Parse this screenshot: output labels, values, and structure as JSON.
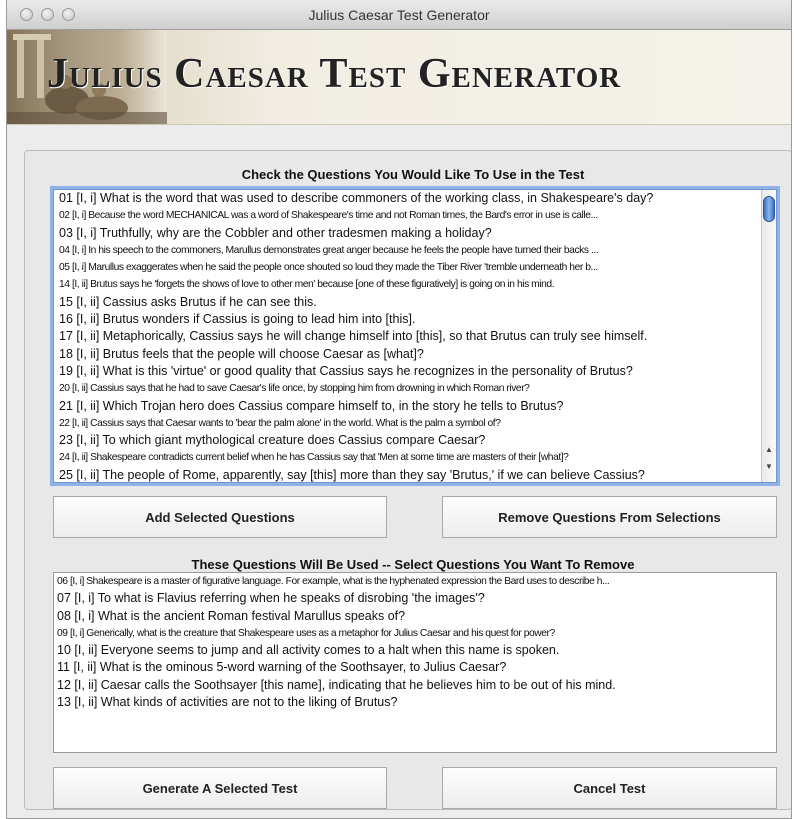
{
  "window": {
    "title": "Julius Caesar Test Generator"
  },
  "banner": {
    "title": "Julius Caesar Test Generator"
  },
  "available": {
    "heading": "Check the Questions You Would Like To Use in the Test",
    "items": [
      {
        "text": "01 [I, i] What is the word that was used to describe commoners of the working class, in Shakespeare's day?",
        "cond": false
      },
      {
        "text": "02 [I, i] Because the word MECHANICAL was a word of Shakespeare's time and not Roman times, the Bard's error in use is calle...",
        "cond": true
      },
      {
        "text": "03 [I, i] Truthfully, why are the Cobbler and other tradesmen making a holiday?",
        "cond": false
      },
      {
        "text": "04 [I, i] In his speech to the commoners, Marullus demonstrates great anger because he feels the people have turned their backs ...",
        "cond": true
      },
      {
        "text": "05 [I, i] Marullus exaggerates when he said the people once shouted so loud they made the Tiber River 'tremble underneath her b...",
        "cond": true
      },
      {
        "text": "14 [I, ii] Brutus says he 'forgets the shows of love to other men' because [one of these figuratively] is going on in his mind.",
        "cond": true
      },
      {
        "text": "15 [I, ii] Cassius asks Brutus if he can see this.",
        "cond": false
      },
      {
        "text": "16 [I, ii] Brutus wonders if Cassius is going to lead him into [this].",
        "cond": false
      },
      {
        "text": "17 [I, ii] Metaphorically, Cassius says he will change himself into [this], so that Brutus can truly see himself.",
        "cond": false
      },
      {
        "text": "18 [I, ii] Brutus feels that the people will choose Caesar as [what]?",
        "cond": false
      },
      {
        "text": "19 [I, ii] What is this 'virtue' or good quality that Cassius says he recognizes in the personality of Brutus?",
        "cond": false
      },
      {
        "text": "20 [I, ii] Cassius says that he had to save Caesar's life once, by stopping him from drowning in which Roman river?",
        "cond": true
      },
      {
        "text": "21 [I, ii] Which Trojan hero does Cassius compare himself to, in the story he tells to Brutus?",
        "cond": false
      },
      {
        "text": "22 [I, ii] Cassius says that Caesar wants to 'bear the palm alone' in the world.  What is the palm a symbol of?",
        "cond": true
      },
      {
        "text": "23 [I, ii] To which giant mythological creature does Cassius compare Caesar?",
        "cond": false
      },
      {
        "text": "24 [I, ii] Shakespeare contradicts current belief when he has Cassius say that 'Men at some time are masters of their [what]?",
        "cond": true
      },
      {
        "text": "25 [I, ii] The people of Rome, apparently, say [this] more than they say 'Brutus,' if we can believe Cassius?",
        "cond": false
      }
    ]
  },
  "buttons": {
    "add": "Add Selected Questions",
    "remove": "Remove Questions From Selections",
    "generate": "Generate A Selected Test",
    "cancel": "Cancel Test"
  },
  "selected": {
    "heading": "These Questions Will Be Used -- Select Questions You Want To Remove",
    "items": [
      {
        "text": "06 [I, i] Shakespeare is a master of figurative language.  For example, what is the hyphenated expression the Bard uses to describe h...",
        "cond": true
      },
      {
        "text": "07 [I, i] To what is Flavius referring when he speaks of disrobing 'the images'?",
        "cond": false
      },
      {
        "text": "08 [I, i] What is the ancient Roman festival Marullus speaks of?",
        "cond": false
      },
      {
        "text": "09 [I, i] Generically, what is the creature that Shakespeare uses as a metaphor for Julius Caesar and his quest for power?",
        "cond": true
      },
      {
        "text": "10 [I, ii] Everyone seems to jump and all activity comes to a halt when this name is spoken.",
        "cond": false
      },
      {
        "text": "11 [I, ii] What is the ominous 5-word warning of the Soothsayer, to Julius Caesar?",
        "cond": false
      },
      {
        "text": "12 [I, ii] Caesar calls the Soothsayer [this name], indicating that he believes him to be out of his mind.",
        "cond": false
      },
      {
        "text": "13 [I, ii] What kinds of activities are not to the liking of Brutus?",
        "cond": false
      }
    ]
  }
}
